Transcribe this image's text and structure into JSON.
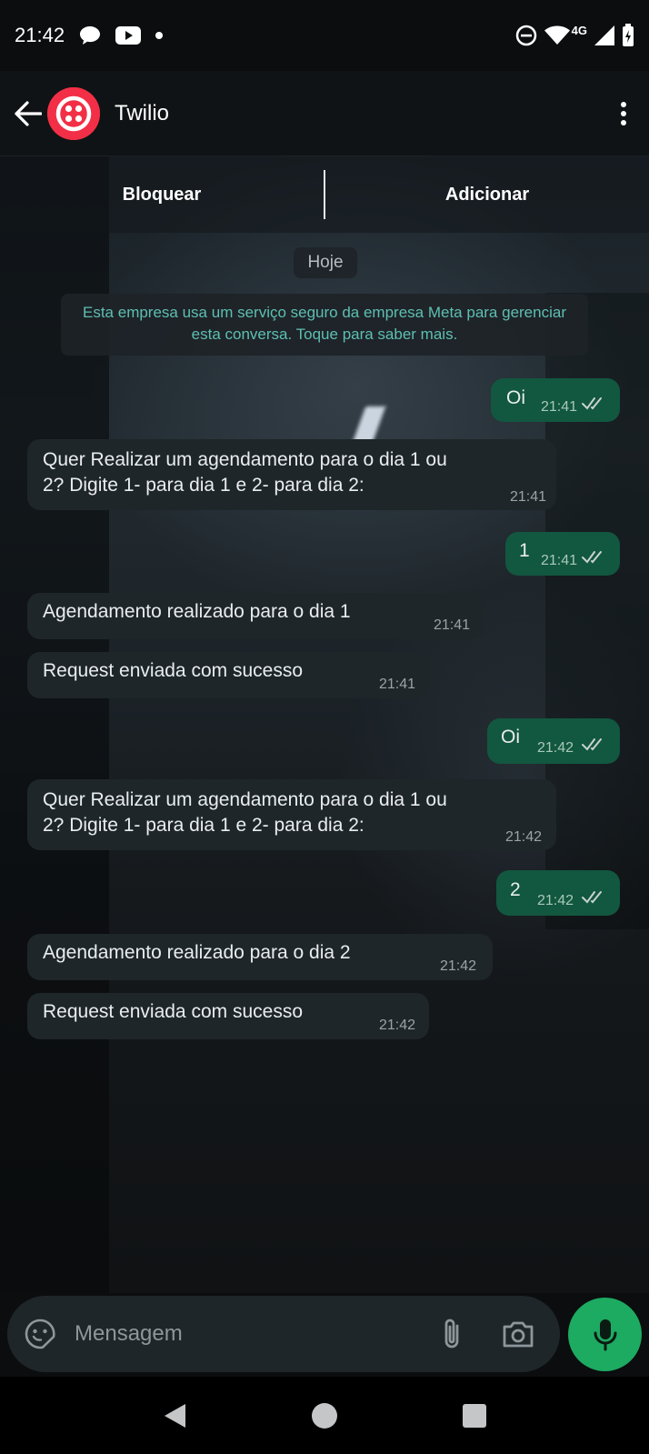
{
  "status_bar": {
    "time": "21:42",
    "network": "4G",
    "icons": [
      "chat-bubble-icon",
      "youtube-icon",
      "dot-icon",
      "do-not-disturb-icon",
      "wifi-icon",
      "signal-icon",
      "battery-icon"
    ]
  },
  "header": {
    "contact_name": "Twilio",
    "avatar_icon": "twilio-logo-icon"
  },
  "actions": {
    "block_label": "Bloquear",
    "add_label": "Adicionar"
  },
  "chat": {
    "date_chip": "Hoje",
    "notice": "Esta empresa usa um serviço seguro da empresa Meta para gerenciar esta conversa. Toque para saber mais.",
    "messages": [
      {
        "direction": "out",
        "text": "Oi",
        "time": "21:41",
        "status": "read"
      },
      {
        "direction": "in",
        "text_line1": "Quer Realizar um agendamento para o dia 1 ou",
        "text_line2": "2? Digite 1- para dia 1 e 2- para dia 2:",
        "time": "21:41"
      },
      {
        "direction": "out",
        "text": "1",
        "time": "21:41",
        "status": "read"
      },
      {
        "direction": "in",
        "text": "Agendamento realizado para o dia 1",
        "time": "21:41"
      },
      {
        "direction": "in",
        "text": "Request enviada com sucesso",
        "time": "21:41"
      },
      {
        "direction": "out",
        "text": "Oi",
        "time": "21:42",
        "status": "read"
      },
      {
        "direction": "in",
        "text_line1": "Quer Realizar um agendamento para o dia 1 ou",
        "text_line2": "2? Digite 1- para dia 1 e 2- para dia 2:",
        "time": "21:42"
      },
      {
        "direction": "out",
        "text": "2",
        "time": "21:42",
        "status": "read"
      },
      {
        "direction": "in",
        "text": "Agendamento realizado para o dia 2",
        "time": "21:42"
      },
      {
        "direction": "in",
        "text": "Request enviada com sucesso",
        "time": "21:42"
      }
    ]
  },
  "composer": {
    "placeholder": "Mensagem"
  },
  "colors": {
    "outgoing_bubble": "#12573f",
    "incoming_bubble": "#1f2629",
    "accent_green": "#1daa61",
    "notice_text": "#5ebfb2",
    "twilio_red": "#f22f46"
  }
}
